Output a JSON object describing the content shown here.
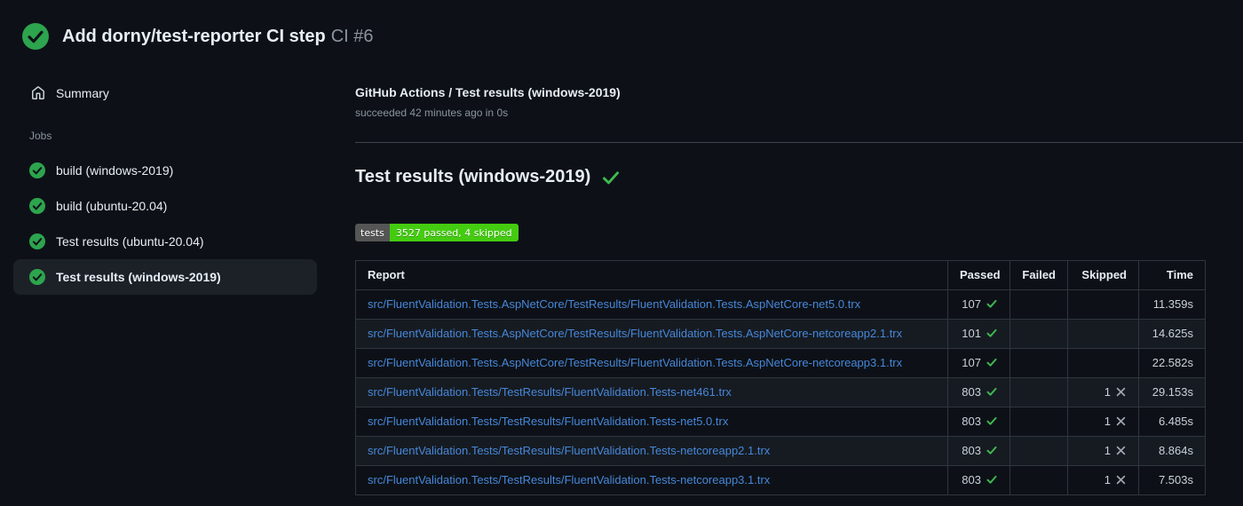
{
  "header": {
    "status": "success",
    "title": "Add dorny/test-reporter CI step",
    "run_label": "CI #6"
  },
  "sidebar": {
    "summary_label": "Summary",
    "jobs_heading": "Jobs",
    "jobs": [
      {
        "label": "build (windows-2019)",
        "status": "success",
        "selected": false
      },
      {
        "label": "build (ubuntu-20.04)",
        "status": "success",
        "selected": false
      },
      {
        "label": "Test results (ubuntu-20.04)",
        "status": "success",
        "selected": false
      },
      {
        "label": "Test results (windows-2019)",
        "status": "success",
        "selected": true
      }
    ]
  },
  "main": {
    "check_name": "GitHub Actions / Test results (windows-2019)",
    "check_status": "succeeded 42 minutes ago in 0s",
    "section_title": "Test results (windows-2019)",
    "badge": {
      "label": "tests",
      "value": "3527 passed, 4 skipped"
    },
    "table": {
      "headers": [
        "Report",
        "Passed",
        "Failed",
        "Skipped",
        "Time"
      ],
      "rows": [
        {
          "report": "src/FluentValidation.Tests.AspNetCore/TestResults/FluentValidation.Tests.AspNetCore-net5.0.trx",
          "passed": 107,
          "failed": null,
          "skipped": null,
          "time": "11.359s"
        },
        {
          "report": "src/FluentValidation.Tests.AspNetCore/TestResults/FluentValidation.Tests.AspNetCore-netcoreapp2.1.trx",
          "passed": 101,
          "failed": null,
          "skipped": null,
          "time": "14.625s"
        },
        {
          "report": "src/FluentValidation.Tests.AspNetCore/TestResults/FluentValidation.Tests.AspNetCore-netcoreapp3.1.trx",
          "passed": 107,
          "failed": null,
          "skipped": null,
          "time": "22.582s"
        },
        {
          "report": "src/FluentValidation.Tests/TestResults/FluentValidation.Tests-net461.trx",
          "passed": 803,
          "failed": null,
          "skipped": 1,
          "time": "29.153s"
        },
        {
          "report": "src/FluentValidation.Tests/TestResults/FluentValidation.Tests-net5.0.trx",
          "passed": 803,
          "failed": null,
          "skipped": 1,
          "time": "6.485s"
        },
        {
          "report": "src/FluentValidation.Tests/TestResults/FluentValidation.Tests-netcoreapp2.1.trx",
          "passed": 803,
          "failed": null,
          "skipped": 1,
          "time": "8.864s"
        },
        {
          "report": "src/FluentValidation.Tests/TestResults/FluentValidation.Tests-netcoreapp3.1.trx",
          "passed": 803,
          "failed": null,
          "skipped": 1,
          "time": "7.503s"
        }
      ]
    }
  },
  "icons": {
    "header_status": "check-circle",
    "summary": "home",
    "job_status": "check-circle",
    "passed": "check",
    "skipped": "x"
  },
  "colors": {
    "accent_green": "#2da44e",
    "check_green": "#3fb950",
    "link_blue": "#4787d8",
    "badge_green": "#44cc11",
    "badge_gray": "#555555",
    "x_gray": "#9ea7b0"
  }
}
